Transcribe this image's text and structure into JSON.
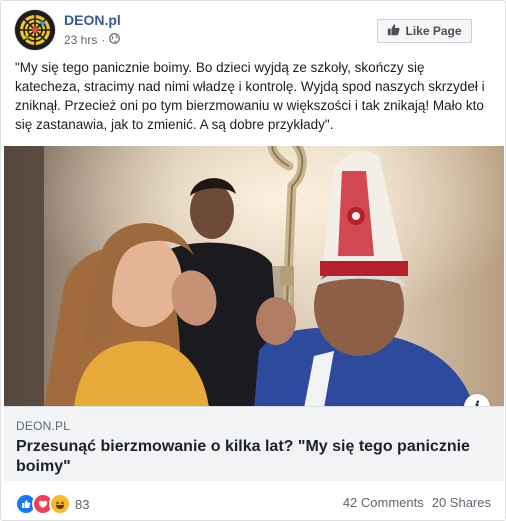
{
  "post": {
    "page_name": "DEON.pl",
    "time": "23 hrs",
    "dot": "·",
    "privacy_icon": "globe-icon",
    "like_page_label": "Like Page",
    "text": "\"My się tego panicznie boimy. Bo dzieci wyjdą ze szkoły, skończy się katecheza, stracimy nad nimi władzę i kontrolę. Wyjdą spod naszych skrzydeł i zniknął. Przecież oni po tym bierzmowaniu w większości i tak znikają! Mało kto się zastanawia, jak to zmienić. A są dobre przykłady\"."
  },
  "link": {
    "domain": "DEON.PL",
    "title": "Przesunąć bierzmowanie o kilka lat? \"My się tego panicznie boimy\"",
    "info_label": "i"
  },
  "footer": {
    "reaction_icons": [
      "like-icon",
      "love-icon",
      "haha-icon"
    ],
    "reaction_count": "83",
    "comments": "42 Comments",
    "shares": "20 Shares"
  },
  "colors": {
    "link_blue": "#385898",
    "like_blue": "#1877f2",
    "love_red": "#f33e58",
    "haha_yellow": "#f7b928"
  }
}
